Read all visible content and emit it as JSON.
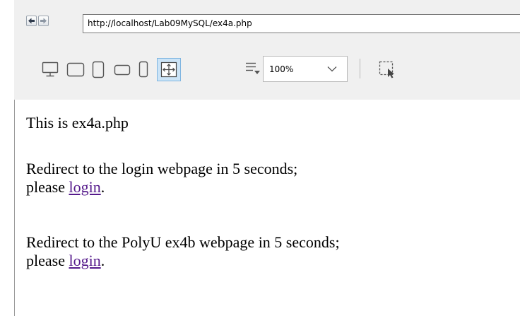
{
  "browser": {
    "url": "http://localhost/Lab09MySQL/ex4a.php",
    "zoom": "100%",
    "toolbar_icons": [
      "desktop-icon",
      "tablet-landscape-icon",
      "tablet-portrait-icon",
      "phone-landscape-icon",
      "phone-portrait-icon",
      "fit-to-window-icon",
      "orientation-menu-icon",
      "select-region-icon"
    ]
  },
  "page": {
    "intro": "This is ex4a.php",
    "para1": {
      "line1": "Redirect to the login webpage in 5 seconds;",
      "prefix": "please ",
      "link": "login",
      "suffix": "."
    },
    "para2": {
      "line1": "Redirect to the PolyU ex4b webpage in 5 seconds;",
      "prefix": "please ",
      "link": "login",
      "suffix": "."
    }
  },
  "colors": {
    "toolbar_bg": "#f0f0f0",
    "link_visited": "#551a8b",
    "active_icon_bg": "#cce4f7"
  }
}
